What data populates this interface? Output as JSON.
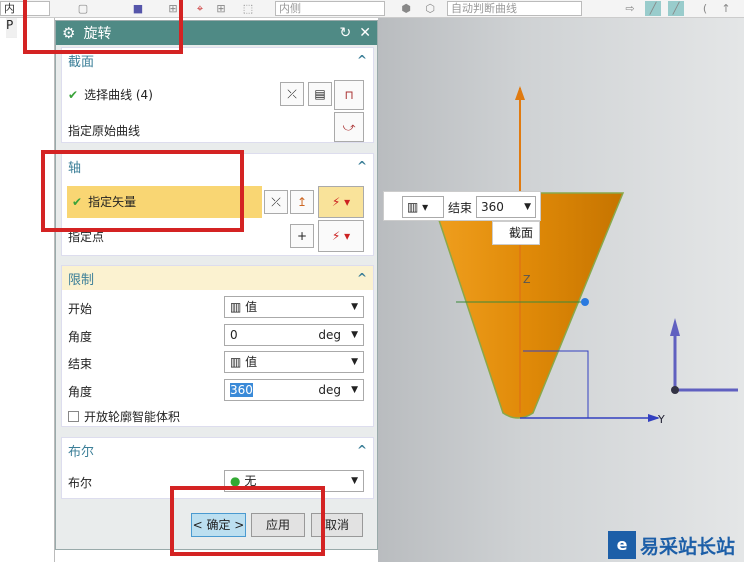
{
  "toolbar": {
    "left_combo": "内",
    "combo_side": "内侧",
    "combo_curve": "自动判断曲线"
  },
  "leftnav": {
    "col_label": "P"
  },
  "dialog": {
    "title": "旋转",
    "section": {
      "title": "截面",
      "select_curve": "选择曲线 (4)",
      "origin_curve": "指定原始曲线"
    },
    "axis": {
      "title": "轴",
      "vector": "指定矢量",
      "point": "指定点"
    },
    "limits": {
      "title": "限制",
      "start_label": "开始",
      "start_value": "值",
      "start_angle_label": "角度",
      "start_angle": "0",
      "end_label": "结束",
      "end_value": "值",
      "end_angle_label": "角度",
      "end_angle": "360",
      "unit": "deg",
      "open_profile": "开放轮廓智能体积"
    },
    "boolean": {
      "title": "布尔",
      "label": "布尔",
      "value": "无"
    },
    "buttons": {
      "ok": "< 确定 >",
      "apply": "应用",
      "cancel": "取消"
    }
  },
  "floating": {
    "end_label": "结束",
    "end_value": "360",
    "tooltip": "截面"
  },
  "viewport": {
    "axis_z": "Z",
    "axis_y": "Y"
  },
  "watermark": {
    "text": "易采站长站"
  },
  "colors": {
    "title": "#4f8a85",
    "cone": "#e8960f",
    "highlight": "#f9d673",
    "redbox": "#d42323"
  }
}
